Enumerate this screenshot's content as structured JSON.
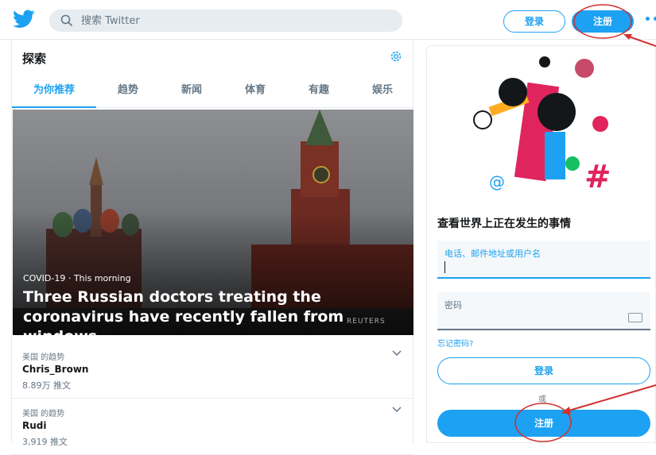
{
  "header": {
    "logo_icon": "twitter-bird-icon",
    "search_placeholder": "搜索 Twitter",
    "login_label": "登录",
    "signup_label": "注册",
    "more_label": "•••"
  },
  "explore": {
    "title": "探索",
    "tabs": [
      {
        "label": "为你推荐",
        "active": true
      },
      {
        "label": "趋势",
        "active": false
      },
      {
        "label": "新闻",
        "active": false
      },
      {
        "label": "体育",
        "active": false
      },
      {
        "label": "有趣",
        "active": false
      },
      {
        "label": "娱乐",
        "active": false
      }
    ],
    "hero": {
      "meta": "COVID-19 · This morning",
      "title": "Three Russian doctors treating the coronavirus have recently fallen from windows",
      "credit": "REUTERS"
    },
    "trends": [
      {
        "context": "美国 的趋势",
        "name": "Chris_Brown",
        "count": "8.89万 推文"
      },
      {
        "context": "美国 的趋势",
        "name": "Rudi",
        "count": "3,919 推文"
      }
    ]
  },
  "signup_panel": {
    "headline": "查看世界上正在发生的事情",
    "username_label": "电话、邮件地址或用户名",
    "password_label": "密码",
    "forgot_link": "忘记密码?",
    "login_label": "登录",
    "or_text": "或",
    "signup_label": "注册"
  },
  "colors": {
    "accent": "#1da1f2",
    "annotation": "#d32f2f"
  }
}
